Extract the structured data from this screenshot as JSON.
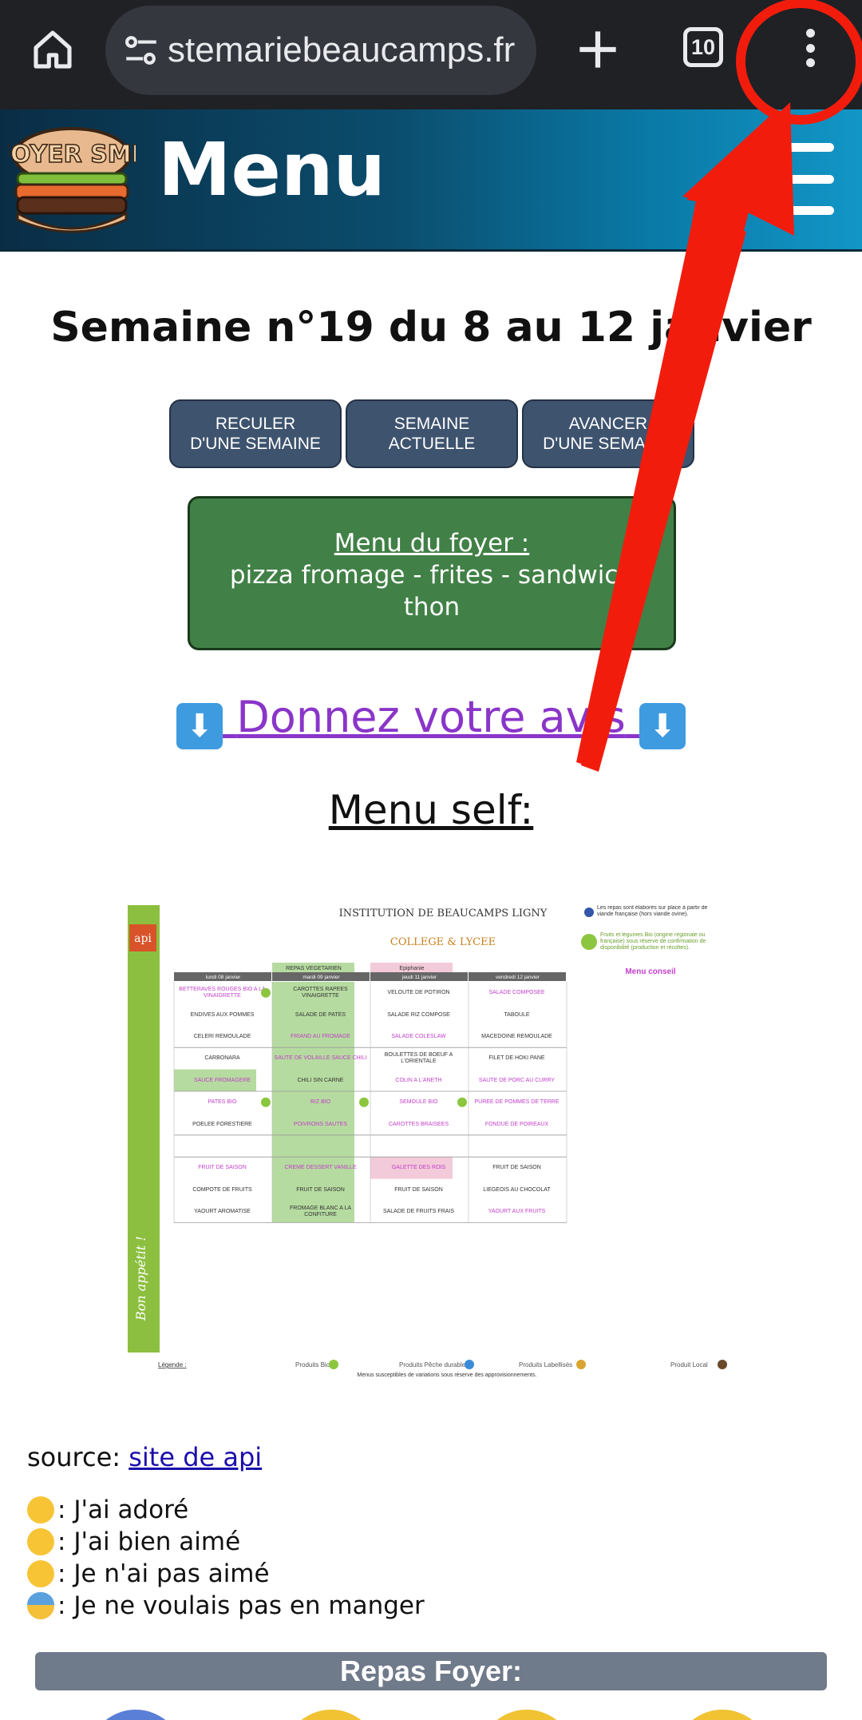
{
  "browser": {
    "url": "stemariebeaucamps.fr",
    "tab_count": "10"
  },
  "header": {
    "title": "Menu",
    "logo_text": "FOYER SMB"
  },
  "page": {
    "week_title": "Semaine n°19 du 8 au 12 janvier",
    "nav_buttons": [
      {
        "line1": "RECULER",
        "line2": "D'UNE SEMAINE"
      },
      {
        "line1": "SEMAINE",
        "line2": "ACTUELLE"
      },
      {
        "line1": "AVANCER",
        "line2": "D'UNE SEMAINE"
      }
    ],
    "foyer_menu": {
      "title": "Menu du foyer :",
      "line1": "pizza fromage - frites - sandwich",
      "line2": "thon"
    },
    "avis_link": "Donnez votre avis",
    "self_title": "Menu self:",
    "source_label": "source:",
    "source_link": "site de api",
    "legend": [
      "J'ai adoré",
      "J'ai bien aimé",
      "Je n'ai pas aimé",
      "Je ne voulais pas en manger"
    ],
    "repas_foyer": "Repas Foyer:"
  },
  "menu_image": {
    "institution": "INSTITUTION DE BEAUCAMPS LIGNY",
    "school": "COLLEGE & LYCEE",
    "note_meat": "Les repas sont élaborés sur place à partir de viande française (hors viande ovine).",
    "note_bio": "Fruits et légumes Bio (origine régionale ou française) sous réserve de confirmation de disponibilité (production et récoltes).",
    "menu_conseil": "Menu conseil",
    "brand": "api",
    "side_text": "Bon appétit !",
    "tags": {
      "vegetarien": "REPAS VEGETARIEN",
      "epiphanie": "Epiphanie"
    },
    "days": [
      "lundi 08 janvier",
      "mardi 09 janvier",
      "jeudi 11 janvier",
      "vendredi 12 janvier"
    ],
    "rows": [
      [
        "BETTERAVES ROUGES BIO A LA VINAIGRETTE",
        "CAROTTES RAPEES VINAIGRETTE",
        "VELOUTE DE POTIRON",
        "SALADE COMPOSEE"
      ],
      [
        "ENDIVES AUX POMMES",
        "SALADE DE PATES",
        "SALADE RIZ COMPOSE",
        "TABOULE"
      ],
      [
        "CELERI REMOULADE",
        "FRIAND AU FROMAGE",
        "SALADE COLESLAW",
        "MACEDOINE REMOULADE"
      ],
      [
        "CARBONARA",
        "SAUTE DE VOLAILLE SAUCE CHILI",
        "BOULETTES DE BOEUF A L'ORIENTALE",
        "FILET DE HOKI PANE"
      ],
      [
        "SAUCE FROMAGERE",
        "CHILI SIN CARNE",
        "COLIN A L'ANETH",
        "SAUTE DE PORC AU CURRY"
      ],
      [
        "PATES BIO",
        "RIZ BIO",
        "SEMOULE BIO",
        "PUREE DE POMMES DE TERRE"
      ],
      [
        "POELEE FORESTIERE",
        "POIVRONS SAUTES",
        "CAROTTES BRAISEES",
        "FONDUE DE POIREAUX"
      ],
      [
        "",
        "",
        "",
        ""
      ],
      [
        "FRUIT DE SAISON",
        "CREME DESSERT VANILLE",
        "GALETTE DES ROIS",
        "FRUIT DE SAISON"
      ],
      [
        "COMPOTE DE FRUITS",
        "FRUIT DE SAISON",
        "FRUIT DE SAISON",
        "LIEGEOIS AU CHOCOLAT"
      ],
      [
        "YAOURT AROMATISE",
        "FROMAGE BLANC A LA CONFITURE",
        "SALADE DE FRUITS FRAIS",
        "YAOURT AUX FRUITS"
      ]
    ],
    "footer_legend": [
      "Légende :",
      "Produits Bio",
      "Produits Pêche durable",
      "Produits Labellisés",
      "Produit Local"
    ],
    "footer_note": "Menus susceptibles de variations sous réserve des approvisionnements.",
    "colors": {
      "green": "#b6dba0",
      "pink": "#f3cad9",
      "magenta": "#c23fc9",
      "header_gray": "#666666"
    }
  },
  "colors": {
    "browser_bg": "#1f2125",
    "header_gradient_start": "#0a2d45",
    "header_gradient_end": "#1296c6",
    "nav_button": "#3e536e",
    "foyer_green": "#418046",
    "link_purple": "#8a35c9",
    "annotation_red": "#f21c0d",
    "repas_bar": "#6f7a8a"
  }
}
